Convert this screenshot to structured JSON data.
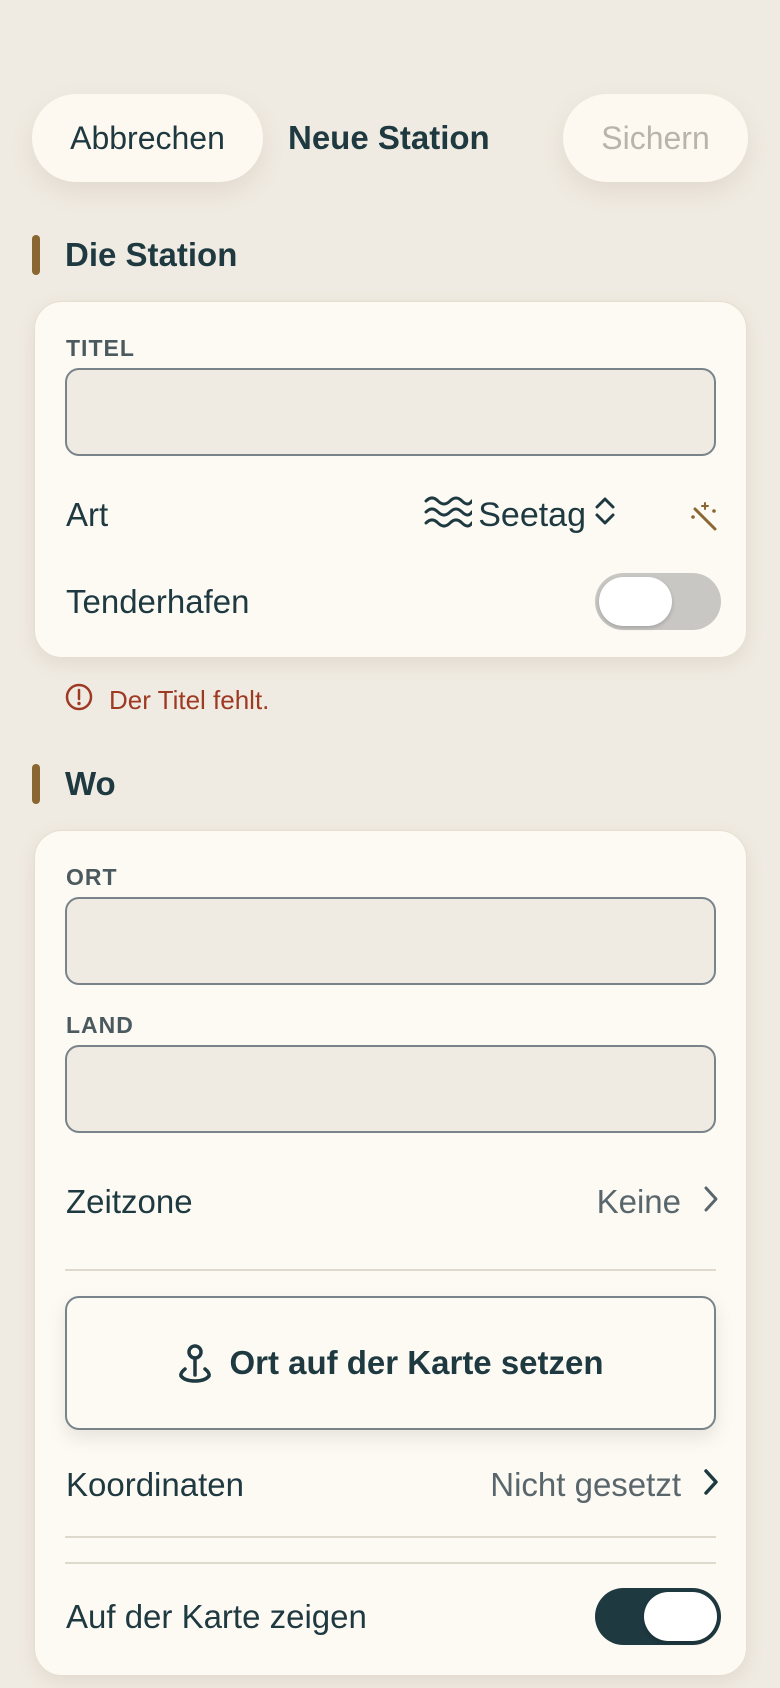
{
  "header": {
    "cancel_label": "Abbrechen",
    "title": "Neue Station",
    "save_label": "Sichern"
  },
  "section_station": {
    "title": "Die Station",
    "title_field": {
      "label": "TITEL",
      "value": "",
      "placeholder": ""
    },
    "type_row": {
      "label": "Art",
      "value": "Seetag",
      "icon": "waves-icon",
      "picker_icon": "chevron-up-down-icon",
      "action_icon": "magic-wand-icon"
    },
    "tender_row": {
      "label": "Tenderhafen",
      "toggle_on": false
    }
  },
  "validation": {
    "message": "Der Titel fehlt.",
    "icon": "exclamation-circle-icon",
    "color": "#9e3a24"
  },
  "section_where": {
    "title": "Wo",
    "place_field": {
      "label": "ORT",
      "value": "",
      "placeholder": ""
    },
    "country_field": {
      "label": "LAND",
      "value": "",
      "placeholder": ""
    },
    "timezone_row": {
      "label": "Zeitzone",
      "value": "Keine",
      "icon": "chevron-right-icon"
    },
    "map_button": {
      "label": "Ort auf der Karte setzen",
      "icon": "map-pin-icon"
    },
    "coordinates_row": {
      "label": "Koordinaten",
      "value": "Nicht gesetzt",
      "icon": "chevron-right-icon"
    },
    "show_on_map_row": {
      "label": "Auf der Karte zeigen",
      "toggle_on": true
    }
  },
  "colors": {
    "background": "#f0ebe2",
    "card": "#fdfaf4",
    "accent_bar": "#8a6632",
    "primary_text": "#1e3940",
    "toggle_on": "#1e3940",
    "toggle_off": "#c8c7c4",
    "disabled_text": "#b9b4aa"
  }
}
